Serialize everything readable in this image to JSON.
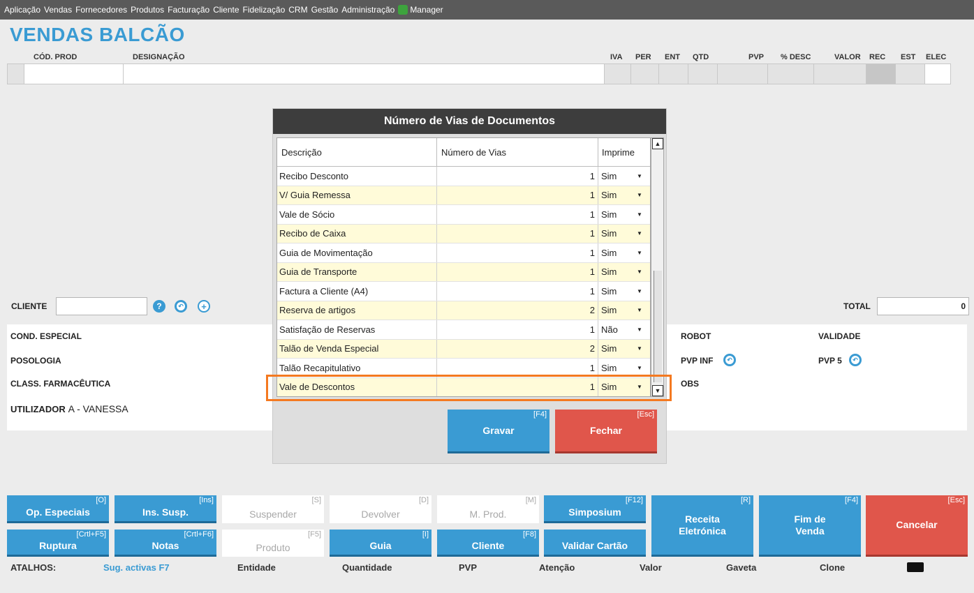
{
  "menu": {
    "items": [
      "Aplicação",
      "Vendas",
      "Fornecedores",
      "Produtos",
      "Facturação",
      "Cliente",
      "Fidelização",
      "CRM",
      "Gestão",
      "Administração"
    ],
    "manager": "Manager"
  },
  "title": "VENDAS BALCÃO",
  "columns": {
    "cod": "CÓD. PROD",
    "designacao": "DESIGNAÇÃO",
    "iva": "IVA",
    "per": "PER",
    "ent": "ENT",
    "qtd": "QTD",
    "pvp": "PVP",
    "desc": "% DESC",
    "valor": "VALOR",
    "rec": "REC",
    "est": "EST",
    "elec": "ELEC"
  },
  "client": {
    "label": "CLIENTE",
    "value": "",
    "help_icon": "help-icon",
    "history_icon": "history-icon",
    "add_icon": "add-circle-icon"
  },
  "total": {
    "label": "TOTAL",
    "value": "0"
  },
  "info": {
    "cond": "COND. ESPECIAL",
    "posologia": "POSOLOGIA",
    "class": "CLASS. FARMACÊUTICA",
    "user_prefix": "UTILIZADOR",
    "user": "A - VANESSA",
    "robot": "ROBOT",
    "validade": "VALIDADE",
    "pvp_inf": "PVP INF",
    "pvp5": "PVP 5",
    "obs": "OBS"
  },
  "modal": {
    "title": "Número de Vias de Documentos",
    "headers": {
      "descricao": "Descrição",
      "vias": "Número de Vias",
      "imprime": "Imprime"
    },
    "rows": [
      {
        "desc": "Recibo Desconto",
        "vias": "1",
        "imprime": "Sim"
      },
      {
        "desc": "V/ Guia Remessa",
        "vias": "1",
        "imprime": "Sim"
      },
      {
        "desc": "Vale de Sócio",
        "vias": "1",
        "imprime": "Sim"
      },
      {
        "desc": "Recibo de Caixa",
        "vias": "1",
        "imprime": "Sim"
      },
      {
        "desc": "Guia de Movimentação",
        "vias": "1",
        "imprime": "Sim"
      },
      {
        "desc": "Guia de Transporte",
        "vias": "1",
        "imprime": "Sim"
      },
      {
        "desc": "Factura a Cliente (A4)",
        "vias": "1",
        "imprime": "Sim"
      },
      {
        "desc": "Reserva de artigos",
        "vias": "2",
        "imprime": "Sim"
      },
      {
        "desc": "Satisfação de Reservas",
        "vias": "1",
        "imprime": "Não"
      },
      {
        "desc": "Talão de Venda Especial",
        "vias": "2",
        "imprime": "Sim"
      },
      {
        "desc": "Talão Recapitulativo",
        "vias": "1",
        "imprime": "Sim"
      },
      {
        "desc": "Vale de Descontos",
        "vias": "1",
        "imprime": "Sim"
      }
    ],
    "gravar": {
      "label": "Gravar",
      "shortcut": "[F4]"
    },
    "fechar": {
      "label": "Fechar",
      "shortcut": "[Esc]"
    }
  },
  "buttons": {
    "op_especiais": {
      "label": "Op. Especiais",
      "shortcut": "[O]"
    },
    "ins_susp": {
      "label": "Ins. Susp.",
      "shortcut": "[Ins]"
    },
    "suspender": {
      "label": "Suspender",
      "shortcut": "[S]"
    },
    "devolver": {
      "label": "Devolver",
      "shortcut": "[D]"
    },
    "m_prod": {
      "label": "M. Prod.",
      "shortcut": "[M]"
    },
    "simposium": {
      "label": "Simposium",
      "shortcut": "[F12]"
    },
    "receita": {
      "label": "Receita Eletrónica",
      "shortcut": "[R]"
    },
    "fim_venda": {
      "label": "Fim de Venda",
      "shortcut": "[F4]"
    },
    "cancelar": {
      "label": "Cancelar",
      "shortcut": "[Esc]"
    },
    "ruptura": {
      "label": "Ruptura",
      "shortcut": "[Crtl+F5]"
    },
    "notas": {
      "label": "Notas",
      "shortcut": "[Crtl+F6]"
    },
    "produto": {
      "label": "Produto",
      "shortcut": "[F5]"
    },
    "guia": {
      "label": "Guia",
      "shortcut": "[I]"
    },
    "cliente": {
      "label": "Cliente",
      "shortcut": "[F8]"
    },
    "validar": {
      "label": "Validar Cartão",
      "shortcut": ""
    }
  },
  "shortcuts": {
    "label": "ATALHOS:",
    "sug": "Sug. activas F7",
    "entidade": "Entidade",
    "quantidade": "Quantidade",
    "pvp": "PVP",
    "atencao": "Atenção",
    "valor": "Valor",
    "gaveta": "Gaveta",
    "clone": "Clone",
    "keyboard_icon": "keyboard-icon"
  },
  "colors": {
    "accent": "#3a9bd3",
    "danger": "#e0564b",
    "highlight": "#f47920",
    "row_alt": "#fffbd9"
  }
}
